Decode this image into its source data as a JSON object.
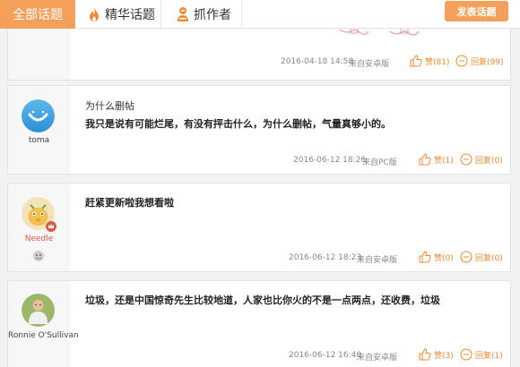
{
  "nav": {
    "tabs": [
      {
        "label": "全部话题",
        "active": true
      },
      {
        "label": "精华话题",
        "icon": "flame-icon"
      },
      {
        "label": "抓作者",
        "icon": "grabber-icon"
      }
    ],
    "post_button": "发表话题"
  },
  "posts": [
    {
      "author": "",
      "title": "",
      "body": "",
      "date": "2016-04-18 14:58",
      "source": "来自安卓版",
      "likes": "赞(81)",
      "replies": "回复(99)"
    },
    {
      "author": "toma",
      "title": "为什么删帖",
      "body": "我只是说有可能烂尾，有没有抨击什么，为什么删帖，气量真够小的。",
      "date": "2016-06-12 18:26",
      "source": "来自PC版",
      "likes": "赞(1)",
      "replies": "回复(0)"
    },
    {
      "author": "Needle",
      "title": "",
      "body": "赶紧更新啦我想看啦",
      "date": "2016-06-12 18:23",
      "source": "来自安卓版",
      "likes": "赞(0)",
      "replies": "回复(0)"
    },
    {
      "author": "Ronnie O'Sullivan",
      "title": "",
      "body": "垃圾，还是中国惊奇先生比较地道，人家也比你火的不是一点两点，还收费，垃圾",
      "date": "2016-06-12 16:40",
      "source": "来自安卓版",
      "likes": "赞(3)",
      "replies": "回复(1)"
    }
  ],
  "colors": {
    "accent": "#f5a05a",
    "action": "#f08a30",
    "page_bg": "#f2f2f2"
  }
}
